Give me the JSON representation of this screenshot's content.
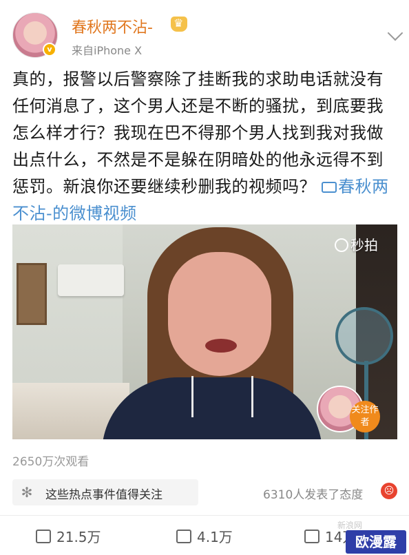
{
  "header": {
    "username": "春秋两不沾-",
    "source": "来自iPhone X",
    "verified_badge": "v",
    "crown_icon": "crown-icon"
  },
  "post": {
    "text": "真的，报警以后警察除了挂断我的求助电话就没有任何消息了，这个男人还是不断的骚扰，到底要我怎么样才行？我现在巴不得那个男人找到我对我做出点什么，不然是不是躲在阴暗处的他永远得不到惩罚。新浪你还要继续秒删我的视频吗？",
    "video_link": "春秋两不沾-的微博视频"
  },
  "video": {
    "watermark": "秒拍",
    "follow_label": "关注作者"
  },
  "stats": {
    "views": "2650万次观看",
    "hot_topic": "这些热点事件值得关注",
    "attitude": "6310人发表了态度"
  },
  "actions": {
    "repost": "21.5万",
    "comment": "4.1万",
    "like": "14万"
  },
  "brand": {
    "logo_text": "欧漫露",
    "faint_mark": "新浪网"
  },
  "colors": {
    "username": "#e0771f",
    "link": "#4a8fcf",
    "follow_button": "#f08a1c",
    "angry_emoji": "#e8432f"
  }
}
